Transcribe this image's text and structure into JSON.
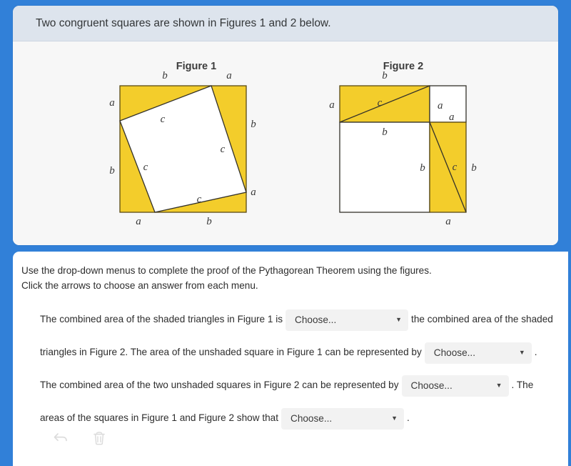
{
  "stimulus": {
    "header_text": "Two congruent squares are shown in Figures 1 and 2 below.",
    "figure1": {
      "title": "Figure 1",
      "labels": {
        "top_left": "b",
        "top_right": "a",
        "left_upper": "a",
        "left_lower": "b",
        "right_upper": "b",
        "right_lower": "a",
        "bottom_left": "a",
        "bottom_right": "b",
        "hyp_top": "c",
        "hyp_right": "c",
        "hyp_left": "c",
        "hyp_bottom": "c"
      }
    },
    "figure2": {
      "title": "Figure 2",
      "labels": {
        "top": "b",
        "left": "a",
        "inner_right_a": "a",
        "inner_top_a": "a",
        "inner_b": "b",
        "inner_left_b": "b",
        "right": "b",
        "bottom": "a",
        "hyp_top": "c",
        "hyp_right": "c"
      }
    }
  },
  "answer": {
    "instructions_line1": "Use the drop-down menus to complete the proof of the Pythagorean Theorem using the figures.",
    "instructions_line2": "Click the arrows to choose an answer from each menu.",
    "segment_1": "The combined area of the shaded triangles in Figure 1 is",
    "segment_2": "the combined area of the shaded triangles in Figure 2. The area of the unshaded square in Figure 1 can be represented by",
    "segment_3": ". The combined area of the two unshaded squares in Figure 2 can be represented by",
    "segment_4": ". The areas of the squares in Figure 1 and Figure 2 show that",
    "segment_5": ".",
    "dropdown_placeholder": "Choose...",
    "dropdown_arrow": "▼",
    "tools": {
      "undo_label": "undo-icon",
      "delete_label": "trash-icon"
    }
  },
  "colors": {
    "page_blue": "#3180d8",
    "shade_yellow": "#f3cd2b",
    "header_band": "#dde4ed",
    "dropdown_bg": "#f2f2f2"
  }
}
